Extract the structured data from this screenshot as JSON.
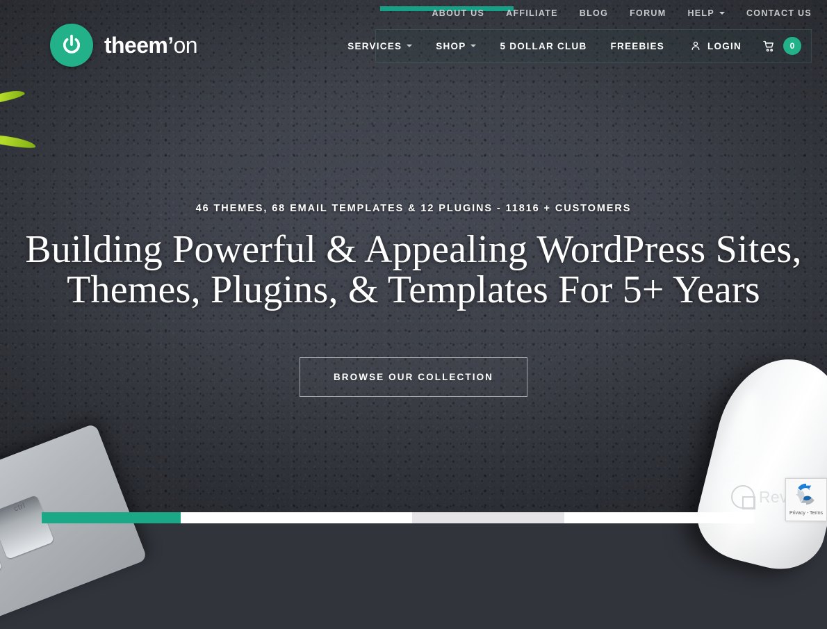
{
  "brand": {
    "name_bold": "theem’",
    "name_light": "on",
    "logo_icon": "power-icon",
    "accent_color": "#22b189"
  },
  "topbar": {
    "items": [
      {
        "label": "About Us",
        "has_dropdown": false
      },
      {
        "label": "Affiliate",
        "has_dropdown": false
      },
      {
        "label": "Blog",
        "has_dropdown": false
      },
      {
        "label": "Forum",
        "has_dropdown": false
      },
      {
        "label": "Help",
        "has_dropdown": true
      },
      {
        "label": "Contact Us",
        "has_dropdown": false
      }
    ]
  },
  "mainnav": {
    "items": [
      {
        "label": "Services",
        "has_dropdown": true
      },
      {
        "label": "Shop",
        "has_dropdown": true
      },
      {
        "label": "5 Dollar Club",
        "has_dropdown": false
      },
      {
        "label": "Freebies",
        "has_dropdown": false
      }
    ],
    "login_label": "Login",
    "login_icon": "user-icon",
    "cart_icon": "cart-icon",
    "cart_count": "0"
  },
  "hero": {
    "eyebrow": "46 Themes, 68 Email Templates & 12 Plugins - 11816 + Customers",
    "title_line1": "Building Powerful & Appealing WordPress Sites,",
    "title_line2": "Themes, Plugins, & Templates For 5+ Years",
    "cta_label": "Browse Our Collection"
  },
  "watermark": {
    "text": "Revain",
    "icon": "revain-logo-icon"
  },
  "recaptcha": {
    "icon": "recaptcha-icon",
    "terms": "Privacy - Terms"
  }
}
